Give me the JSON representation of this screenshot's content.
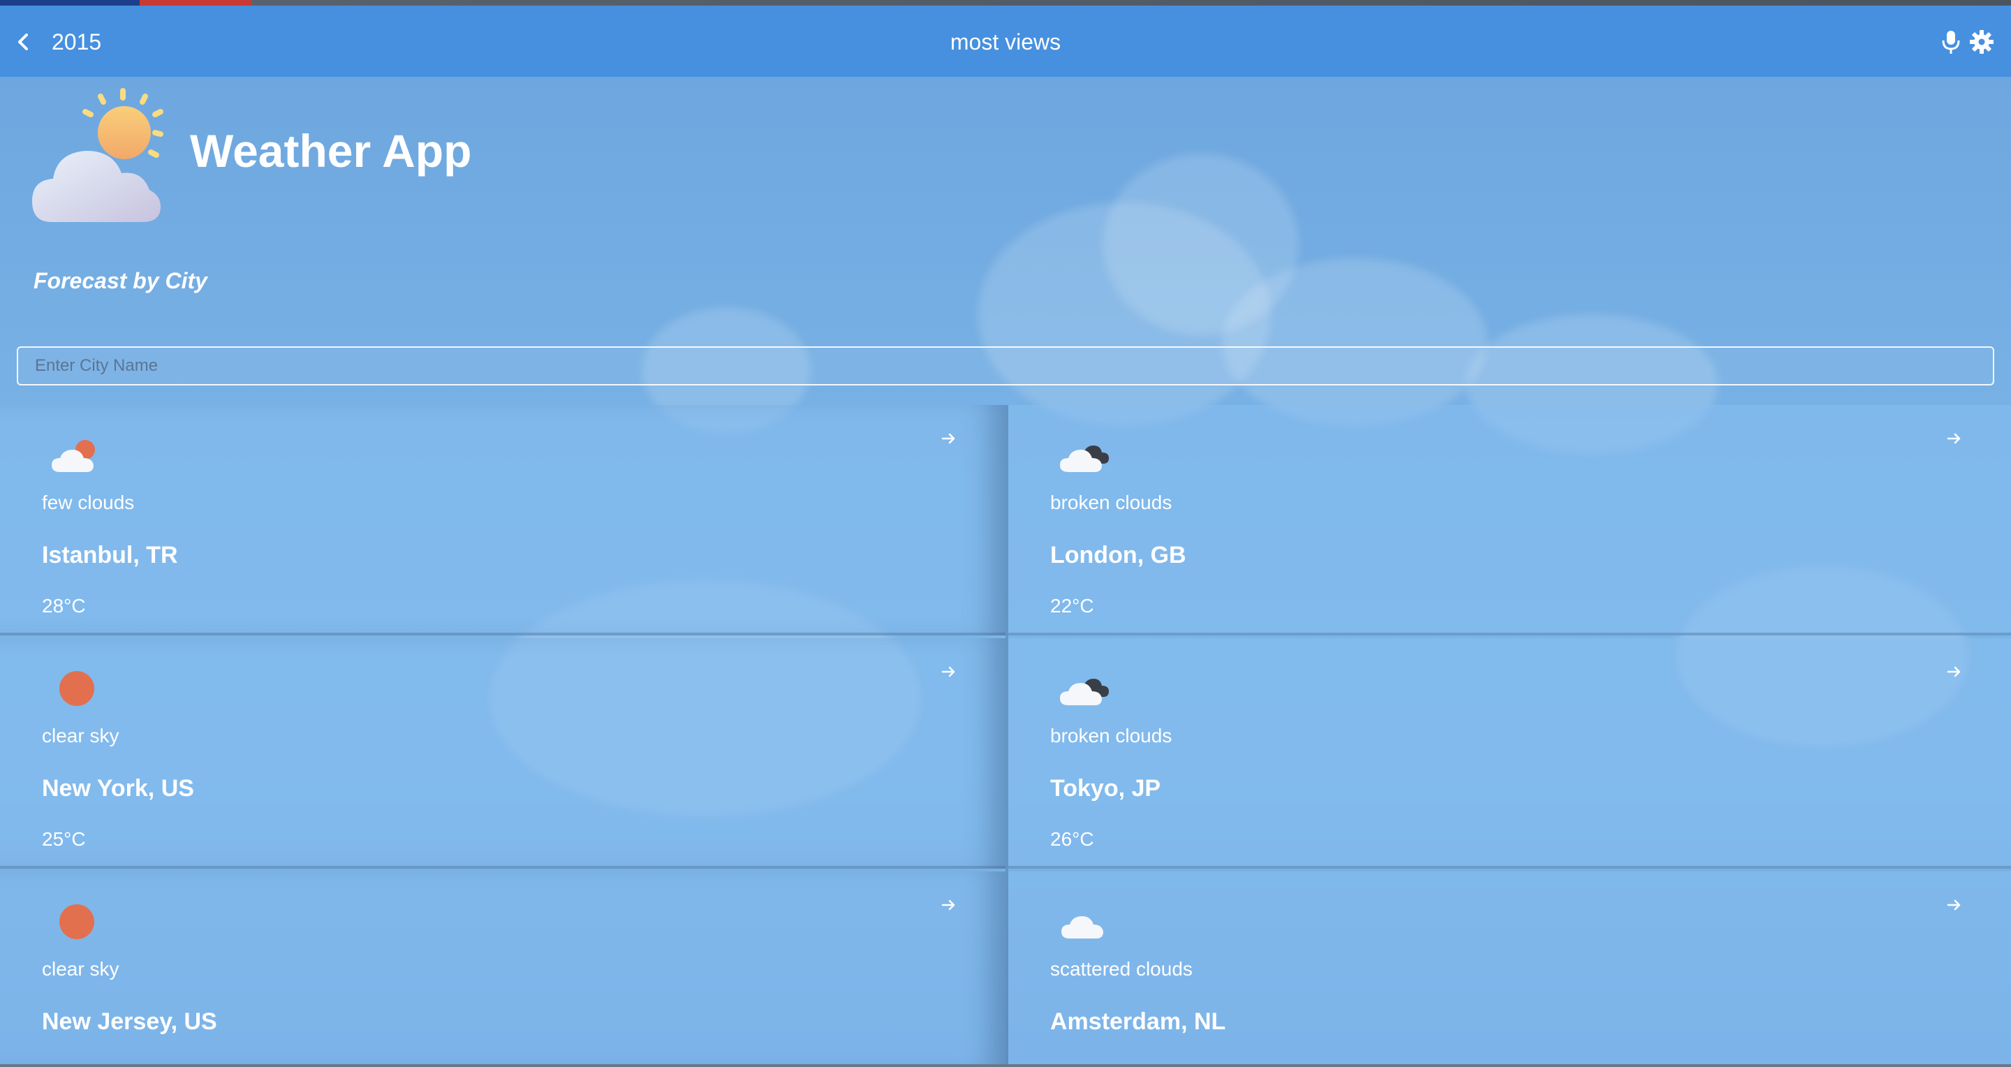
{
  "header": {
    "year": "2015",
    "title": "most views"
  },
  "app": {
    "title": "Weather App",
    "subtitle": "Forecast by City"
  },
  "search": {
    "placeholder": "Enter City Name",
    "value": ""
  },
  "cities": [
    {
      "description": "few clouds",
      "name": "Istanbul, TR",
      "temp": "28°C",
      "icon": "few-clouds-icon"
    },
    {
      "description": "broken clouds",
      "name": "London, GB",
      "temp": "22°C",
      "icon": "broken-clouds-icon"
    },
    {
      "description": "clear sky",
      "name": "New York, US",
      "temp": "25°C",
      "icon": "clear-sky-icon"
    },
    {
      "description": "broken clouds",
      "name": "Tokyo, JP",
      "temp": "26°C",
      "icon": "broken-clouds-icon"
    },
    {
      "description": "clear sky",
      "name": "New Jersey, US",
      "temp": "",
      "icon": "clear-sky-icon"
    },
    {
      "description": "scattered clouds",
      "name": "Amsterdam, NL",
      "temp": "",
      "icon": "scattered-clouds-icon"
    }
  ],
  "colors": {
    "header": "#4690df",
    "sun": "#e2704f",
    "dark_cloud": "#3a3f47"
  }
}
